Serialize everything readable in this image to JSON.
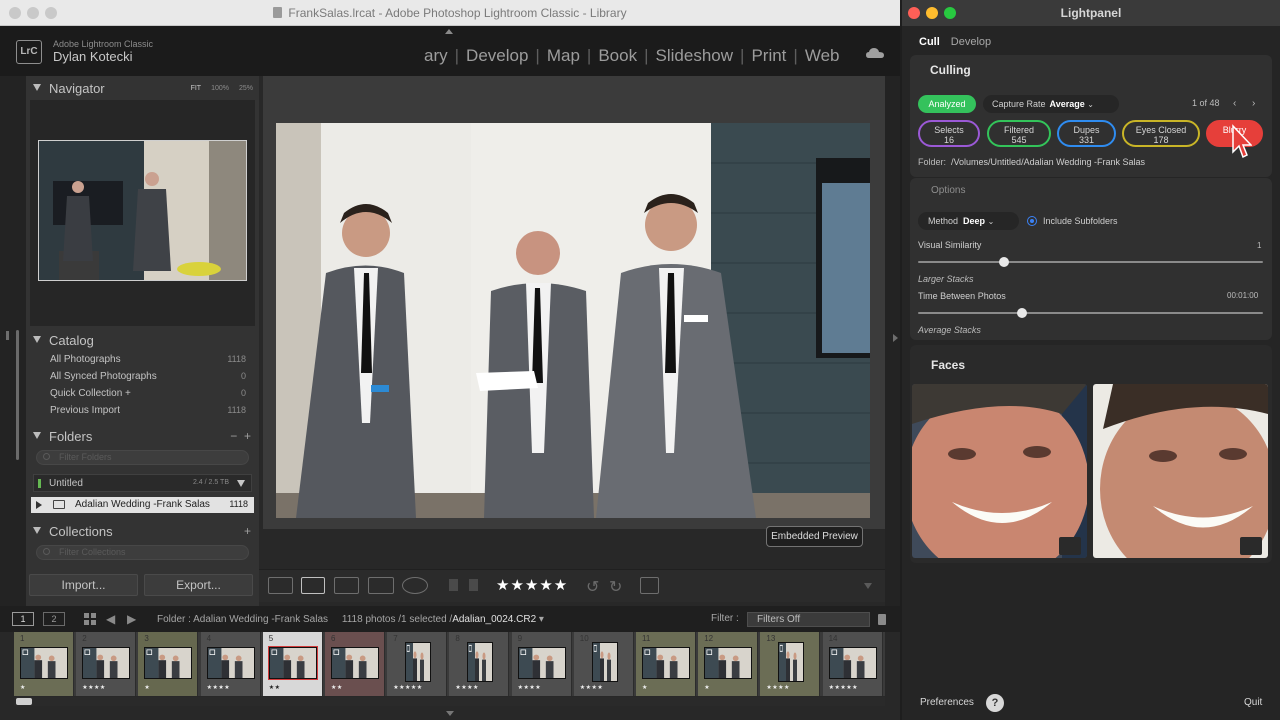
{
  "lr": {
    "window_title": "FrankSalas.lrcat - Adobe Photoshop Lightroom Classic - Library",
    "identity": {
      "logo": "LrC",
      "product": "Adobe Lightroom Classic",
      "user": "Dylan Kotecki"
    },
    "modules": [
      "ary",
      "Develop",
      "Map",
      "Book",
      "Slideshow",
      "Print",
      "Web"
    ],
    "navigator": {
      "label": "Navigator",
      "zoom_options": [
        "FIT",
        "100%",
        "25%"
      ]
    },
    "catalog": {
      "label": "Catalog",
      "items": [
        {
          "name": "All Photographs",
          "count": "1118"
        },
        {
          "name": "All Synced Photographs",
          "count": "0"
        },
        {
          "name": "Quick Collection +",
          "count": "0"
        },
        {
          "name": "Previous Import",
          "count": "1118"
        }
      ]
    },
    "folders": {
      "label": "Folders",
      "filter_placeholder": "Filter Folders",
      "volume": {
        "name": "Untitled",
        "size": "2.4 / 2.5 TB"
      },
      "folder": {
        "name": "Adalian Wedding -Frank Salas",
        "count": "1118"
      }
    },
    "collections": {
      "label": "Collections",
      "filter_placeholder": "Filter Collections"
    },
    "buttons": {
      "import": "Import...",
      "export": "Export..."
    },
    "center": {
      "embedded_preview": "Embedded Preview"
    },
    "toolbar": {
      "stars": "★★★★★"
    },
    "filmbar": {
      "monitor1": "1",
      "monitor2": "2",
      "source_label": "Folder : Adalian Wedding -Frank Salas",
      "photo_count": "1118 photos /1 selected /",
      "selected_file": "Adalian_0024.CR2",
      "filter_label": "Filter :",
      "filter_value": "Filters Off"
    },
    "filmstrip": [
      {
        "num": "1",
        "stars": "★"
      },
      {
        "num": "2",
        "stars": "★★★★"
      },
      {
        "num": "3",
        "stars": "★"
      },
      {
        "num": "4",
        "stars": "★★★★"
      },
      {
        "num": "5",
        "stars": "★★"
      },
      {
        "num": "6",
        "stars": "★★"
      },
      {
        "num": "7",
        "stars": "★★★★★"
      },
      {
        "num": "8",
        "stars": "★★★★"
      },
      {
        "num": "9",
        "stars": "★★★★"
      },
      {
        "num": "10",
        "stars": "★★★★"
      },
      {
        "num": "11",
        "stars": "★"
      },
      {
        "num": "12",
        "stars": "★"
      },
      {
        "num": "13",
        "stars": "★★★★"
      },
      {
        "num": "14",
        "stars": "★★★★★"
      }
    ]
  },
  "lightpanel": {
    "title": "Lightpanel",
    "tabs": [
      "Cull",
      "Develop"
    ],
    "culling": {
      "heading": "Culling",
      "status": "Analyzed",
      "capture_label": "Capture Rate",
      "capture_value": "Average",
      "pager": "1 of 48",
      "pills": [
        {
          "label": "Selects",
          "count": "16",
          "color": "#9b59d6"
        },
        {
          "label": "Filtered",
          "count": "545",
          "color": "#33c45a"
        },
        {
          "label": "Dupes",
          "count": "331",
          "color": "#2f8cf0"
        },
        {
          "label": "Eyes Closed",
          "count": "178",
          "color": "#c9b527"
        },
        {
          "label": "Blurry",
          "count": "1",
          "color": "#e63f3a"
        }
      ],
      "folder_label": "Folder:",
      "folder_path": "/Volumes/Untitled/Adalian Wedding -Frank Salas"
    },
    "options": {
      "heading": "Options",
      "method_label": "Method",
      "method_value": "Deep",
      "include_subfolders": "Include Subfolders",
      "visual_similarity_label": "Visual Similarity",
      "visual_similarity_value": "1",
      "visual_similarity_fraction": 0.25,
      "visual_similarity_hint": "Larger Stacks",
      "time_between_label": "Time Between Photos",
      "time_between_value": "00:01:00",
      "time_between_fraction": 0.3,
      "time_between_hint": "Average Stacks"
    },
    "faces": {
      "heading": "Faces"
    },
    "footer": {
      "preferences": "Preferences",
      "help": "?",
      "quit": "Quit"
    }
  }
}
